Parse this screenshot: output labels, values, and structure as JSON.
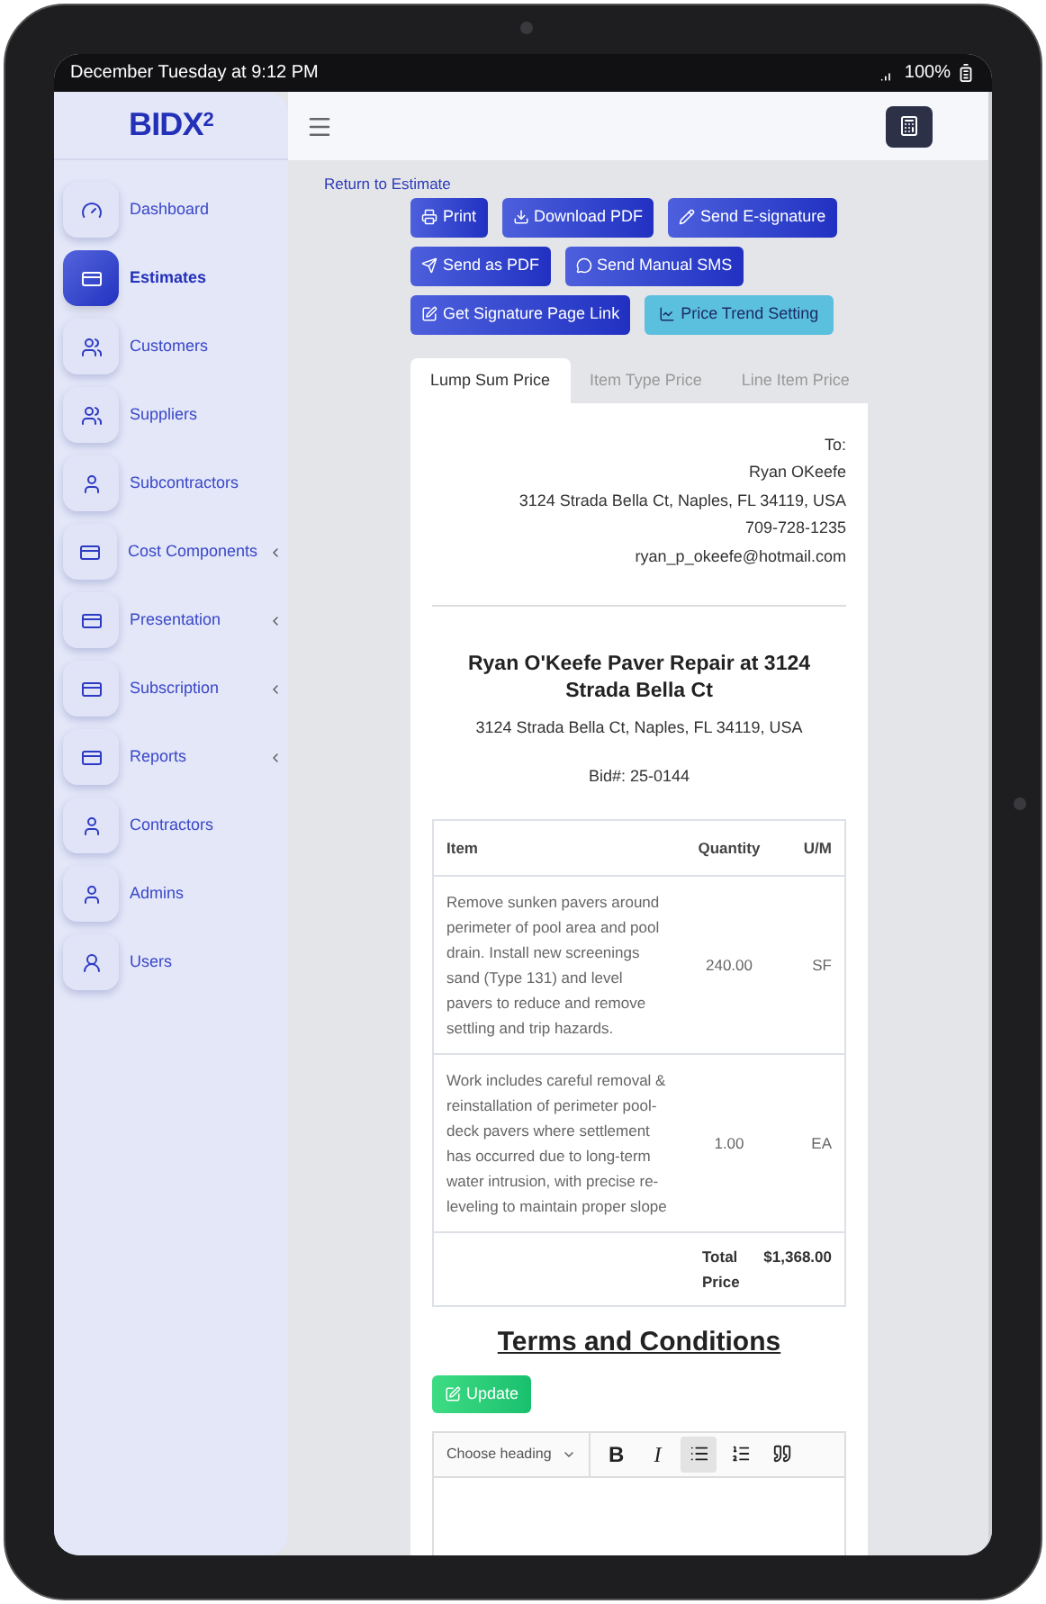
{
  "status_bar": {
    "time": "December Tuesday at 9:12 PM",
    "battery": "100%"
  },
  "logo": {
    "text": "BIDX",
    "sup": "2"
  },
  "sidebar": {
    "items": [
      {
        "label": "Dashboard",
        "selected": false,
        "submenu": false
      },
      {
        "label": "Estimates",
        "selected": true,
        "submenu": false
      },
      {
        "label": "Customers",
        "selected": false,
        "submenu": false
      },
      {
        "label": "Suppliers",
        "selected": false,
        "submenu": false
      },
      {
        "label": "Subcontractors",
        "selected": false,
        "submenu": false
      },
      {
        "label": "Cost Components",
        "selected": false,
        "submenu": true
      },
      {
        "label": "Presentation",
        "selected": false,
        "submenu": true
      },
      {
        "label": "Subscription",
        "selected": false,
        "submenu": true
      },
      {
        "label": "Reports",
        "selected": false,
        "submenu": true
      },
      {
        "label": "Contractors",
        "selected": false,
        "submenu": false
      },
      {
        "label": "Admins",
        "selected": false,
        "submenu": false
      },
      {
        "label": "Users",
        "selected": false,
        "submenu": false
      }
    ]
  },
  "return_link": "Return to Estimate",
  "actions": [
    [
      {
        "label": "Print",
        "kind": "primary"
      },
      {
        "label": "Download PDF",
        "kind": "primary"
      },
      {
        "label": "Send E-signature",
        "kind": "primary"
      }
    ],
    [
      {
        "label": "Send as PDF",
        "kind": "primary"
      },
      {
        "label": "Send Manual SMS",
        "kind": "primary"
      }
    ],
    [
      {
        "label": "Get Signature Page Link",
        "kind": "primary"
      },
      {
        "label": "Price Trend Setting",
        "kind": "info"
      }
    ]
  ],
  "tabs": [
    {
      "label": "Lump Sum Price",
      "selected": true
    },
    {
      "label": "Item Type Price",
      "selected": false
    },
    {
      "label": "Line Item Price",
      "selected": false
    }
  ],
  "recipient": [
    "To:",
    "Ryan OKeefe",
    "3124 Strada Bella Ct, Naples, FL 34119, USA",
    "709-728-1235",
    "ryan_p_okeefe@hotmail.com"
  ],
  "project": {
    "title": "Ryan O'Keefe Paver Repair at 3124 Strada Bella Ct",
    "address": "3124 Strada Bella Ct, Naples, FL 34119, USA",
    "bid": "Bid#: 25-0144"
  },
  "table": {
    "columns": [
      "Item",
      "Quantity",
      "U/M"
    ],
    "rows": [
      [
        "Remove sunken pavers around perimeter of pool area and pool drain. Install new screenings sand (Type 131) and level pavers to reduce and remove settling and trip hazards.",
        "240.00",
        "SF"
      ],
      [
        "Work includes careful removal & reinstallation of perimeter pool-deck pavers where settlement has occurred due to long-term water intrusion, with precise re-leveling to maintain proper slope",
        "1.00",
        "EA"
      ]
    ],
    "total_label": "Total Price",
    "total": "$1,368.00"
  },
  "terms": {
    "title": "Terms and Conditions",
    "update": "Update"
  },
  "editor": {
    "heading": "Choose heading",
    "tools": [
      {
        "kind": "bold",
        "label": "B",
        "selected": false
      },
      {
        "kind": "italic",
        "label": "I",
        "selected": false
      },
      {
        "kind": "bullets",
        "selected": true
      },
      {
        "kind": "numbers",
        "selected": false
      },
      {
        "kind": "quote",
        "selected": false
      }
    ]
  }
}
